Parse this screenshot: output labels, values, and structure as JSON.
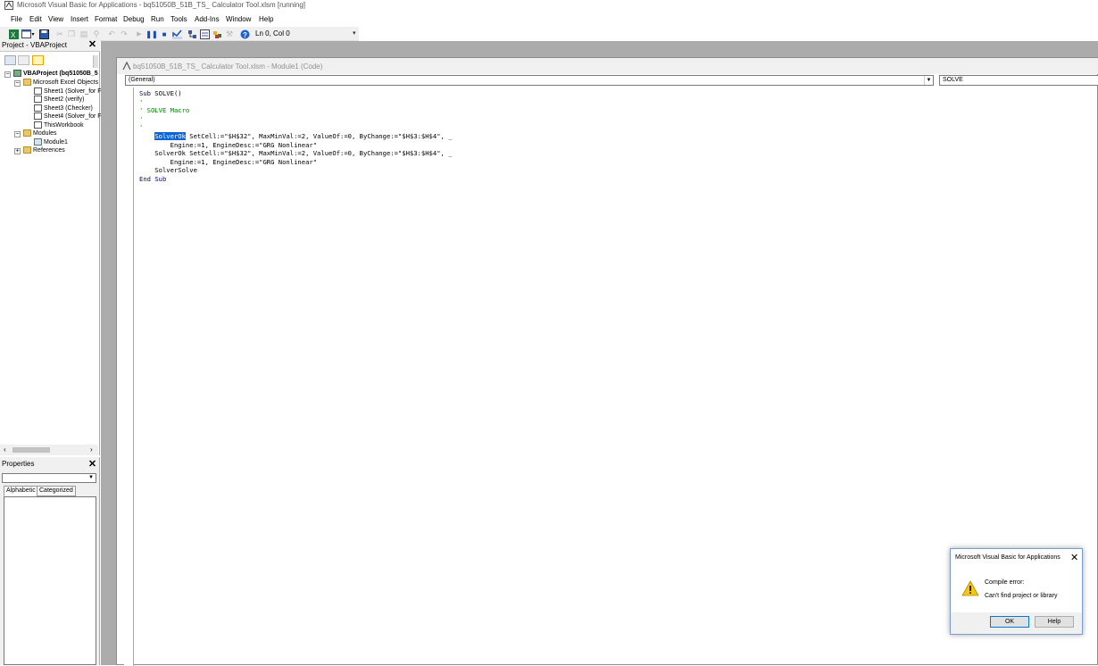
{
  "window": {
    "title": "Microsoft Visual Basic for Applications - bq51050B_51B_TS_ Calculator Tool.xlsm [running]"
  },
  "menu": [
    "File",
    "Edit",
    "View",
    "Insert",
    "Format",
    "Debug",
    "Run",
    "Tools",
    "Add-Ins",
    "Window",
    "Help"
  ],
  "toolbar": {
    "position": "Ln 0, Col 0"
  },
  "project": {
    "title": "Project - VBAProject",
    "tree": {
      "root": "VBAProject (bq51050B_5",
      "excel_objects": "Microsoft Excel Objects",
      "sheets": [
        "Sheet1 (Solver_for F",
        "Sheet2 (verify)",
        "Sheet3 (Checker)",
        "Sheet4 (Solver_for F",
        "ThisWorkbook"
      ],
      "modules": "Modules",
      "module1": "Module1",
      "references": "References"
    }
  },
  "properties": {
    "title": "Properties",
    "tabs": [
      "Alphabetic",
      "Categorized"
    ]
  },
  "code_window": {
    "title": "bq51050B_51B_TS_ Calculator Tool.xlsm - Module1 (Code)",
    "object_combo": "(General)",
    "proc_combo": "SOLVE",
    "lines": {
      "l1_kw": "Sub",
      "l1_rest": " SOLVE()",
      "l2": "'",
      "l3": "' SOLVE Macro",
      "l4": "'",
      "l5": "",
      "l6": "'",
      "l7_sel": "SolverOk",
      "l7_rest": " SetCell:=\"$H$32\", MaxMinVal:=2, ValueOf:=0, ByChange:=\"$H$3:$H$4\", _",
      "l8": "        Engine:=1, EngineDesc:=\"GRG Nonlinear\"",
      "l9": "    SolverOk SetCell:=\"$H$32\", MaxMinVal:=2, ValueOf:=0, ByChange:=\"$H$3:$H$4\", _",
      "l10": "        Engine:=1, EngineDesc:=\"GRG Nonlinear\"",
      "l11": "    SolverSolve",
      "l12_kw": "End Sub"
    }
  },
  "dialog": {
    "title": "Microsoft Visual Basic for Applications",
    "line1": "Compile error:",
    "line2": "Can't find project or library",
    "ok": "OK",
    "help": "Help"
  }
}
